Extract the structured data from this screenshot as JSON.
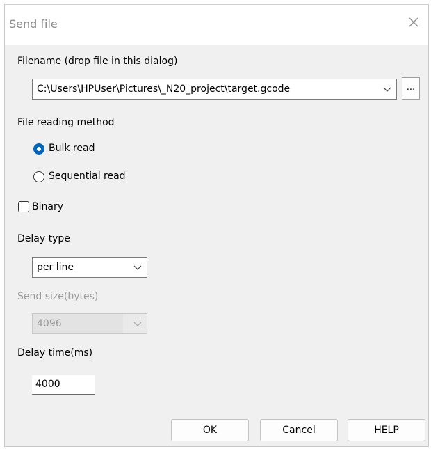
{
  "window": {
    "title": "Send file"
  },
  "filename": {
    "label": "Filename (drop file in this dialog)",
    "value": "C:\\Users\\HPUser\\Pictures\\_N20_project\\target.gcode",
    "browse_label": "..."
  },
  "reading_method": {
    "label": "File reading method",
    "options": [
      {
        "label": "Bulk read",
        "selected": true
      },
      {
        "label": "Sequential read",
        "selected": false
      }
    ]
  },
  "binary": {
    "label": "Binary",
    "checked": false
  },
  "delay_type": {
    "label": "Delay type",
    "value": "per line"
  },
  "send_size": {
    "label": "Send size(bytes)",
    "value": "4096",
    "enabled": false
  },
  "delay_time": {
    "label": "Delay time(ms)",
    "value": "4000"
  },
  "buttons": {
    "ok": "OK",
    "cancel": "Cancel",
    "help": "HELP"
  },
  "colors": {
    "accent": "#0067c0",
    "dialog_bg": "#f0f0f0",
    "disabled_text": "#9a9a9a"
  }
}
